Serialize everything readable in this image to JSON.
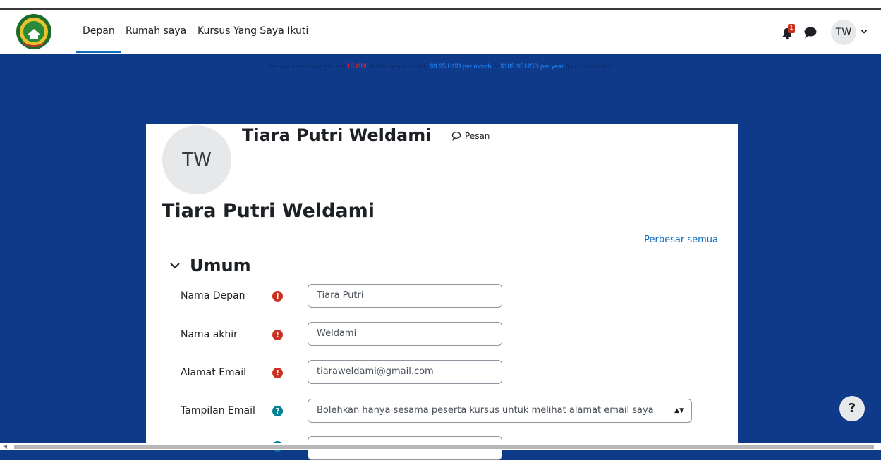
{
  "nav": {
    "items": [
      {
        "label": "Depan",
        "active": true
      },
      {
        "label": "Rumah saya",
        "active": false
      },
      {
        "label": "Kursus Yang Saya Ikuti",
        "active": false
      }
    ],
    "notification_count": "1",
    "user_initials": "TW"
  },
  "ad_banner": {
    "part1": "Remove advertising and get ",
    "highlight": "10 GB!",
    "part2": " of disk space for only ",
    "price_month": "$9.95 USD per month",
    "part3": " or ",
    "price_year": "$109.95 USD per year",
    "part4": " (plus local taxes)."
  },
  "profile": {
    "initials": "TW",
    "name": "Tiara Putri Weldami",
    "message_label": "Pesan"
  },
  "page_title": "Tiara Putri Weldami",
  "expand_all": "Perbesar semua",
  "section": {
    "title": "Umum",
    "fields": [
      {
        "label": "Nama Depan",
        "icon": "required-icon",
        "value": "Tiara Putri"
      },
      {
        "label": "Nama akhir",
        "icon": "required-icon",
        "value": "Weldami"
      },
      {
        "label": "Alamat Email",
        "icon": "required-icon",
        "value": "tiaraweldami@gmail.com"
      },
      {
        "label": "Tampilan Email",
        "icon": "help-icon",
        "value": "Bolehkan hanya sesama peserta kursus untuk melihat alamat email saya"
      }
    ]
  },
  "help_button": "?",
  "colors": {
    "banner_bg": "#0f3a8a",
    "link": "#0f6cbf",
    "required": "#ca3120",
    "help": "#008196"
  }
}
